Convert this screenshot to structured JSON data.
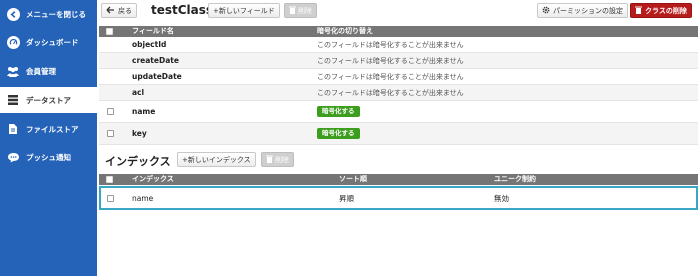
{
  "sidebar": {
    "items": [
      {
        "label": "メニューを閉じる",
        "icon": "arrow-left-circle-icon",
        "active": false
      },
      {
        "label": "ダッシュボード",
        "icon": "dashboard-gauge-icon",
        "active": false
      },
      {
        "label": "会員管理",
        "icon": "users-icon",
        "active": false
      },
      {
        "label": "データストア",
        "icon": "database-icon",
        "active": true
      },
      {
        "label": "ファイルストア",
        "icon": "file-icon",
        "active": false
      },
      {
        "label": "プッシュ通知",
        "icon": "chat-bubble-icon",
        "active": false
      }
    ]
  },
  "toolbar": {
    "back_label": "戻る",
    "class_name": "testClass",
    "add_field_label": "+新しいフィールド",
    "delete_label": "削除",
    "permission_label": "パーミッションの設定",
    "delete_class_label": "クラスの削除"
  },
  "fields_table": {
    "headers": [
      "フィールド名",
      "暗号化の切り替え"
    ],
    "rows": [
      {
        "name": "objectId",
        "toggle": "このフィールドは暗号化することが出来ません",
        "checkbox": false,
        "button": false
      },
      {
        "name": "createDate",
        "toggle": "このフィールドは暗号化することが出来ません",
        "checkbox": false,
        "button": false
      },
      {
        "name": "updateDate",
        "toggle": "このフィールドは暗号化することが出来ません",
        "checkbox": false,
        "button": false
      },
      {
        "name": "acl",
        "toggle": "このフィールドは暗号化することが出来ません",
        "checkbox": false,
        "button": false
      },
      {
        "name": "name",
        "toggle": "暗号化する",
        "checkbox": true,
        "button": true
      },
      {
        "name": "key",
        "toggle": "暗号化する",
        "checkbox": true,
        "button": true
      }
    ]
  },
  "index_section": {
    "title": "インデックス",
    "add_index_label": "+新しいインデックス",
    "delete_label": "削除",
    "headers": [
      "インデックス",
      "ソート順",
      "ユニーク制約"
    ],
    "rows": [
      {
        "name": "name",
        "sort": "昇順",
        "unique": "無効"
      }
    ]
  },
  "colors": {
    "sidebar": "#2563b9",
    "header": "#757575",
    "encrypt_button": "#3d9e1e",
    "danger": "#b71c1c",
    "highlight": "#3aa6c6"
  }
}
